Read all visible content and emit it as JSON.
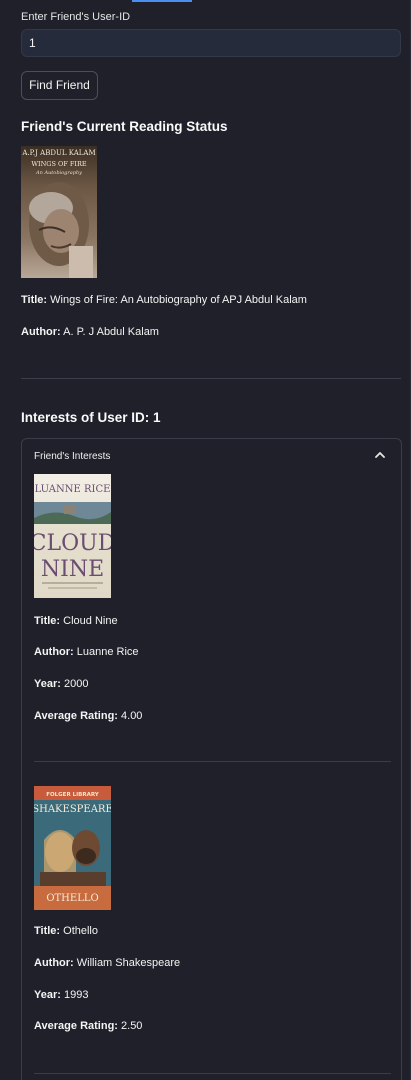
{
  "search": {
    "label": "Enter Friend's User-ID",
    "value": "1",
    "button_label": "Find Friend"
  },
  "current_status": {
    "heading": "Friend's Current Reading Status",
    "cover_text_top": "A.P.J ABDUL KALAM",
    "cover_text_title": "WINGS OF FIRE",
    "cover_text_sub": "An Autobiography",
    "title_label": "Title:",
    "title": "Wings of Fire: An Autobiography of APJ Abdul Kalam",
    "author_label": "Author:",
    "author": "A. P. J Abdul Kalam"
  },
  "interests": {
    "heading": "Interests of User ID: 1",
    "expander_label": "Friend's Interests",
    "books": [
      {
        "cover_author": "LUANNE RICE",
        "cover_title_1": "CLOUD",
        "cover_title_2": "NINE",
        "title_label": "Title:",
        "title": "Cloud Nine",
        "author_label": "Author:",
        "author": "Luanne Rice",
        "year_label": "Year:",
        "year": "2000",
        "rating_label": "Average Rating:",
        "rating": "4.00"
      },
      {
        "cover_series": "FOLGER LIBRARY",
        "cover_author": "SHAKESPEARE",
        "cover_title": "OTHELLO",
        "title_label": "Title:",
        "title": "Othello",
        "author_label": "Author:",
        "author": "William Shakespeare",
        "year_label": "Year:",
        "year": "1993",
        "rating_label": "Average Rating:",
        "rating": "2.50"
      }
    ]
  },
  "colors": {
    "background": "#1f2029",
    "input_bg": "#262b3b",
    "accent": "#4a8ef0",
    "text": "#fafafa"
  },
  "icons": {
    "expander_toggle": "chevron-up-icon"
  }
}
